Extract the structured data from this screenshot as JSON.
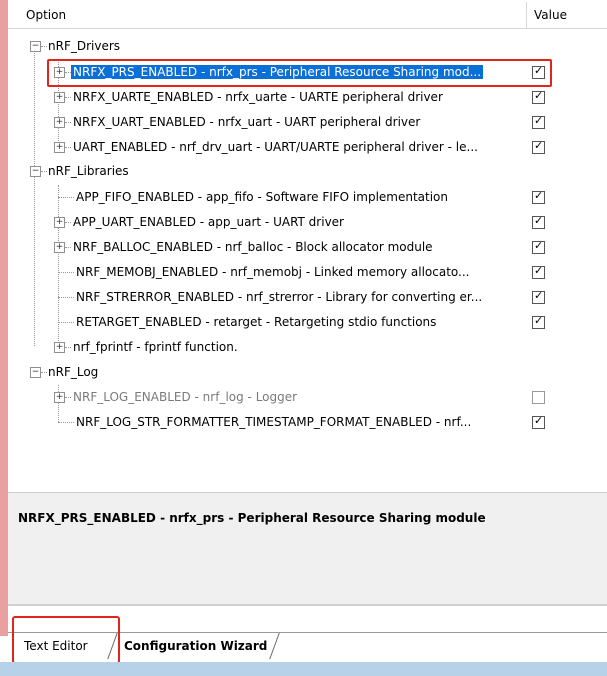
{
  "header": {
    "option_label": "Option",
    "value_label": "Value"
  },
  "tree": {
    "groups": [
      {
        "label": "nRF_Drivers",
        "items": [
          {
            "label": "NRFX_PRS_ENABLED - nrfx_prs - Peripheral Resource Sharing mod...",
            "checked": true,
            "expandable": true,
            "selected": true
          },
          {
            "label": "NRFX_UARTE_ENABLED - nrfx_uarte - UARTE peripheral driver",
            "checked": true,
            "expandable": true
          },
          {
            "label": "NRFX_UART_ENABLED - nrfx_uart - UART peripheral driver",
            "checked": true,
            "expandable": true
          },
          {
            "label": "UART_ENABLED - nrf_drv_uart - UART/UARTE peripheral driver - le...",
            "checked": true,
            "expandable": true
          }
        ]
      },
      {
        "label": "nRF_Libraries",
        "items": [
          {
            "label": "APP_FIFO_ENABLED  - app_fifo - Software FIFO implementation",
            "checked": true,
            "expandable": false
          },
          {
            "label": "APP_UART_ENABLED - app_uart - UART driver",
            "checked": true,
            "expandable": true
          },
          {
            "label": "NRF_BALLOC_ENABLED - nrf_balloc - Block allocator module",
            "checked": true,
            "expandable": true
          },
          {
            "label": "NRF_MEMOBJ_ENABLED  - nrf_memobj - Linked memory allocato...",
            "checked": true,
            "expandable": false
          },
          {
            "label": "NRF_STRERROR_ENABLED  - nrf_strerror - Library for converting er...",
            "checked": true,
            "expandable": false
          },
          {
            "label": "RETARGET_ENABLED  - retarget - Retargeting stdio functions",
            "checked": true,
            "expandable": false
          },
          {
            "label": "nrf_fprintf - fprintf function.",
            "checked": null,
            "expandable": true
          }
        ]
      },
      {
        "label": "nRF_Log",
        "items": [
          {
            "label": "NRF_LOG_ENABLED - nrf_log - Logger",
            "checked": false,
            "expandable": true,
            "disabled": true
          },
          {
            "label": "NRF_LOG_STR_FORMATTER_TIMESTAMP_FORMAT_ENABLED  - nrf...",
            "checked": true,
            "expandable": false
          }
        ]
      }
    ]
  },
  "description": "NRFX_PRS_ENABLED - nrfx_prs - Peripheral Resource Sharing module",
  "tabs": [
    "Text Editor",
    "Configuration Wizard"
  ],
  "colors": {
    "selection": "#0a6fd6",
    "highlight_box": "#e0261a",
    "footer": "#b7d2e8"
  }
}
